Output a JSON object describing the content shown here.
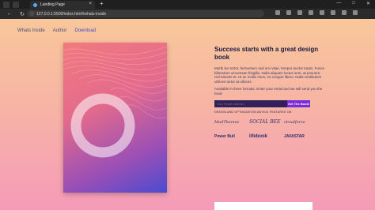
{
  "browser": {
    "tab_title": "Landing Page",
    "tab_close": "×",
    "new_tab": "+",
    "win_min": "—",
    "win_max": "□",
    "win_close": "✕",
    "url": "127.0.0.1:5500/index.html#whats-inside",
    "nav_back": "←",
    "nav_reload": "↻"
  },
  "nav": {
    "items": [
      {
        "label": "Whats Inside"
      },
      {
        "label": "Author"
      },
      {
        "label": "Download"
      }
    ]
  },
  "hero": {
    "headline": "Success starts with a great design book",
    "paragraph": "Morbi leo tortor, fermentum sed orci vitae, tempor auctor turpis. Fusce bibendum accumsan fringilla. Nulla aliquam luctus sem, at posuere nisl lobortis et. Ut ac mollis risus, eu congue libero. Nulla vestibulum ultrices tortor at ultrices.",
    "paragraph2": "Available in three formats. Enter your email and we will send you the book",
    "email_placeholder": "Your Email Address",
    "button_label": "Get The Book!",
    "featured_label": "DESIGN AND OPTIMIZATION ADVICE FEATURED ON"
  },
  "logos": [
    {
      "label": "ModThemes"
    },
    {
      "label": "SOCIAL BEE"
    },
    {
      "label": "cloudforce"
    },
    {
      "label": "Power Bull"
    },
    {
      "label": "lifebook"
    },
    {
      "label": "JAVASTAR"
    }
  ]
}
